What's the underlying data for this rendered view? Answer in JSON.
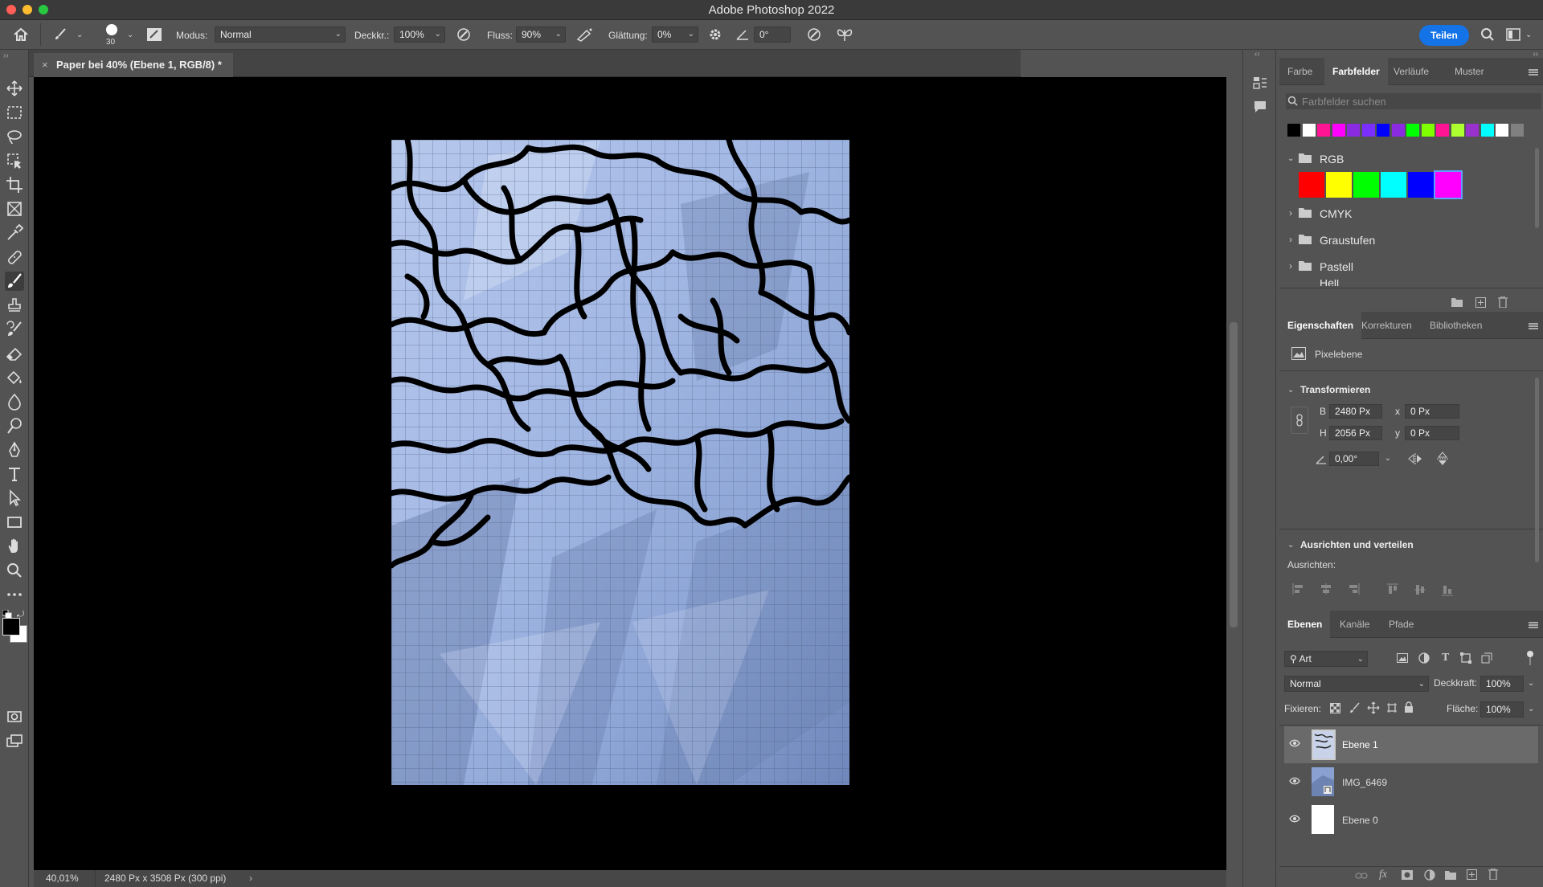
{
  "window": {
    "title": "Adobe Photoshop 2022",
    "share_button": "Teilen"
  },
  "options_bar": {
    "brush_size": "30",
    "mode_label": "Modus:",
    "mode_value": "Normal",
    "opacity_label": "Deckkr.:",
    "opacity_value": "100%",
    "flow_label": "Fluss:",
    "flow_value": "90%",
    "smoothing_label": "Glättung:",
    "smoothing_value": "0%",
    "angle_value": "0°"
  },
  "document": {
    "tab_title": "Paper bei 40% (Ebene 1, RGB/8) *",
    "zoom": "40,01%",
    "doc_info": "2480 Px x 3508 Px (300 ppi)"
  },
  "swatches_panel": {
    "tabs": [
      "Farbe",
      "Farbfelder",
      "Verläufe",
      "Muster"
    ],
    "active_tab": "Farbfelder",
    "search_placeholder": "Farbfelder suchen",
    "recent_colors": [
      "#000000",
      "#ffffff",
      "#ff1493",
      "#ff00ff",
      "#8a2be2",
      "#7b2fff",
      "#0000ff",
      "#8a2be2",
      "#00ff00",
      "#7fff00",
      "#ff1493",
      "#adff2f",
      "#9932cc",
      "#00ffff",
      "#ffffff",
      "#808080"
    ],
    "groups": [
      {
        "name": "RGB",
        "expanded": true,
        "colors": [
          "#ff0000",
          "#ffff00",
          "#00ff00",
          "#00ffff",
          "#0000ff",
          "#ff00ff"
        ]
      },
      {
        "name": "CMYK",
        "expanded": false
      },
      {
        "name": "Graustufen",
        "expanded": false
      },
      {
        "name": "Pastell",
        "expanded": false
      },
      {
        "name": "Hell",
        "expanded": false
      }
    ]
  },
  "properties_panel": {
    "tabs": [
      "Eigenschaften",
      "Korrekturen",
      "Bibliotheken"
    ],
    "active_tab": "Eigenschaften",
    "layer_type": "Pixelebene",
    "transform_title": "Transformieren",
    "w_label": "B",
    "w_value": "2480 Px",
    "h_label": "H",
    "h_value": "2056 Px",
    "x_label": "x",
    "x_value": "0 Px",
    "y_label": "y",
    "y_value": "0 Px",
    "angle_value": "0,00°",
    "align_title": "Ausrichten und verteilen",
    "align_label": "Ausrichten:",
    "more": "..."
  },
  "layers_panel": {
    "tabs": [
      "Ebenen",
      "Kanäle",
      "Pfade"
    ],
    "active_tab": "Ebenen",
    "filter_kind": "Art",
    "blend_mode": "Normal",
    "opacity_label": "Deckkraft:",
    "opacity_value": "100%",
    "lock_label": "Fixieren:",
    "fill_label": "Fläche:",
    "fill_value": "100%",
    "layers": [
      {
        "name": "Ebene 1",
        "selected": true
      },
      {
        "name": "IMG_6469",
        "selected": false
      },
      {
        "name": "Ebene 0",
        "selected": false
      }
    ]
  }
}
